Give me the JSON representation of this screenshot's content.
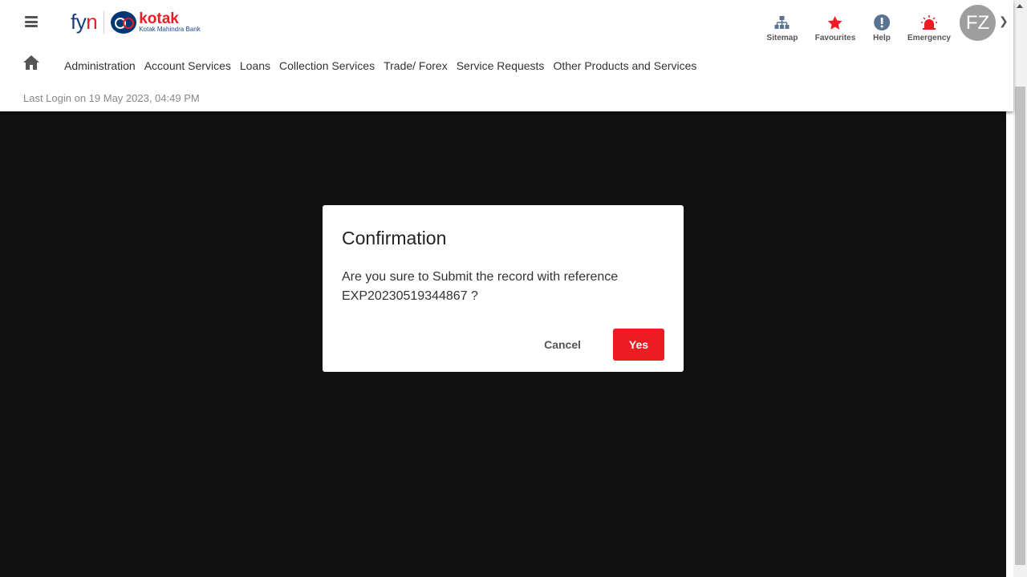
{
  "header": {
    "logo": {
      "fyn": "fyn",
      "brand": "kotak",
      "brand_sub": "Kotak Mahindra Bank"
    },
    "tools": [
      {
        "label": "Sitemap",
        "icon": "sitemap-icon"
      },
      {
        "label": "Favourites",
        "icon": "star-icon"
      },
      {
        "label": "Help",
        "icon": "help-icon"
      },
      {
        "label": "Emergency",
        "icon": "siren-icon"
      }
    ],
    "avatar": "FZ"
  },
  "nav": [
    "Administration",
    "Account Services",
    "Loans",
    "Collection Services",
    "Trade/ Forex",
    "Service Requests",
    "Other Products and Services"
  ],
  "last_login": "Last Login on 19 May 2023, 04:49 PM",
  "dialog": {
    "title": "Confirmation",
    "message_line1": "Are you sure to Submit the record with reference",
    "message_line2": "EXP20230519344867 ?",
    "cancel": "Cancel",
    "yes": "Yes"
  },
  "colors": {
    "brand_red": "#ed1c24",
    "brand_blue": "#003874",
    "icon_blue": "#5b7393"
  }
}
